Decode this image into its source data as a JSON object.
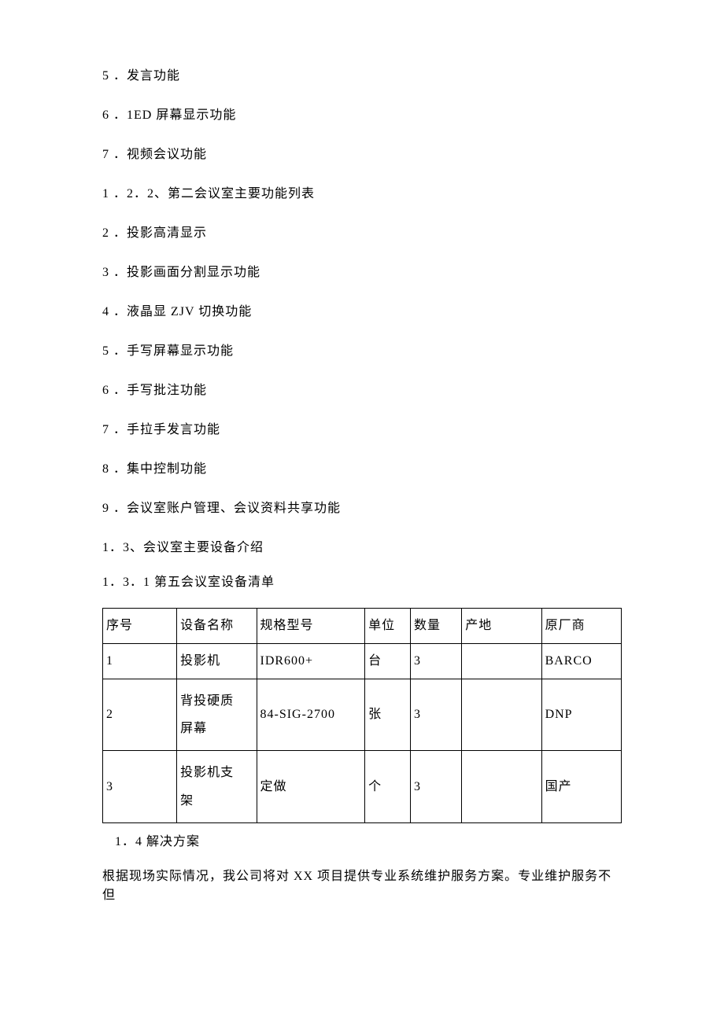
{
  "lines": {
    "l1": "5 ．发言功能",
    "l2": "6 ．1ED 屏幕显示功能",
    "l3": "7 ．视频会议功能",
    "l4": "1 ．2．2、第二会议室主要功能列表",
    "l5": "2 ．投影高清显示",
    "l6": "3 ．投影画面分割显示功能",
    "l7": "4 ．液晶显 ZJV 切换功能",
    "l8": "5 ．手写屏幕显示功能",
    "l9": "6 ．手写批注功能",
    "l10": "7 ．手拉手发言功能",
    "l11": "8 ．集中控制功能",
    "l12": "9 ．会议室账户管理、会议资料共享功能",
    "l13": "1．3、会议室主要设备介绍",
    "l14": "1．3．1 第五会议室设备清单"
  },
  "table": {
    "headers": {
      "seq": "序号",
      "name": "设备名称",
      "model": "规格型号",
      "unit": "单位",
      "qty": "数量",
      "origin": "产地",
      "vendor": "原厂商"
    },
    "rows": [
      {
        "seq": "1",
        "name": "投影机",
        "model": "IDR600+",
        "unit": "台",
        "qty": "3",
        "origin": "",
        "vendor": "BARCO"
      },
      {
        "seq": "2",
        "name": "背投硬质\n屏幕",
        "model": "84-SIG-2700",
        "unit": "张",
        "qty": "3",
        "origin": "",
        "vendor": "DNP"
      },
      {
        "seq": "3",
        "name": "投影机支\n架",
        "model": "定做",
        "unit": "个",
        "qty": "3",
        "origin": "",
        "vendor": "国产"
      }
    ]
  },
  "after": {
    "a1": "1．4 解决方案",
    "a2": "根据现场实际情况，我公司将对 XX 项目提供专业系统维护服务方案。专业维护服务不但"
  }
}
